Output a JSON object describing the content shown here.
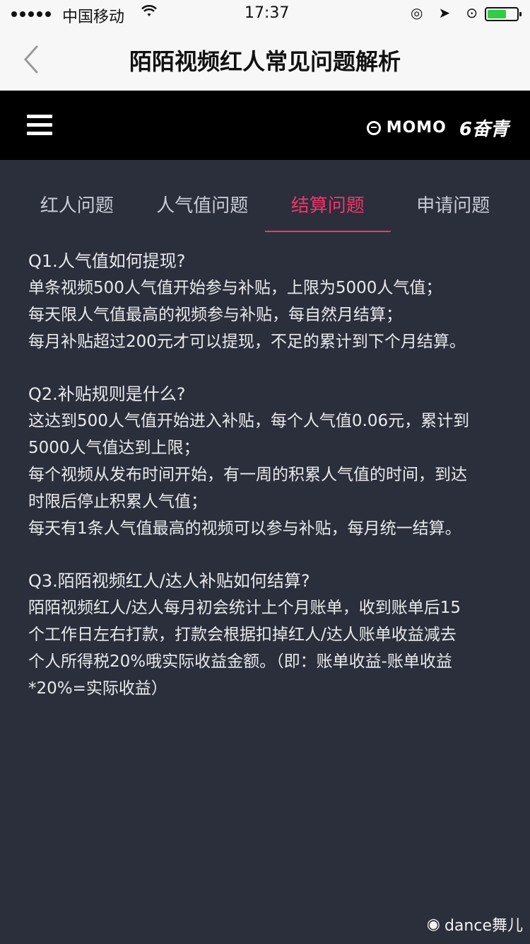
{
  "status_bar": {
    "carrier": "中国移动",
    "time": "17:37"
  },
  "nav": {
    "title": "陌陌视频红人常见问题解析"
  },
  "appbar": {
    "brand_momo": "MOMO",
    "brand_fenqing": "奋青"
  },
  "tabs": [
    {
      "label": "红人问题"
    },
    {
      "label": "人气值问题"
    },
    {
      "label": "结算问题"
    },
    {
      "label": "申请问题"
    }
  ],
  "faq": [
    {
      "q": "Q1.人气值如何提现?",
      "lines": [
        "单条视频500人气值开始参与补贴，上限为5000人气值；",
        "每天限人气值最高的视频参与补贴，每自然月结算；",
        "每月补贴超过200元才可以提现，不足的累计到下个月结算。"
      ]
    },
    {
      "q": "Q2.补贴规则是什么?",
      "lines": [
        "这达到500人气值开始进入补贴，每个人气值0.06元，累计到",
        "5000人气值达到上限；",
        "每个视频从发布时间开始，有一周的积累人气值的时间，到达",
        "时限后停止积累人气值；",
        "每天有1条人气值最高的视频可以参与补贴，每月统一结算。"
      ]
    },
    {
      "q": "Q3.陌陌视频红人/达人补贴如何结算?",
      "lines": [
        "陌陌视频红人/达人每月初会统计上个月账单，收到账单后15",
        "个工作日左右打款，打款会根据扣掉红人/达人账单收益减去",
        "个人所得税20%哦实际收益金额。（即：账单收益-账单收益",
        "*20%=实际收益）"
      ]
    }
  ],
  "watermark": "dance舞儿"
}
